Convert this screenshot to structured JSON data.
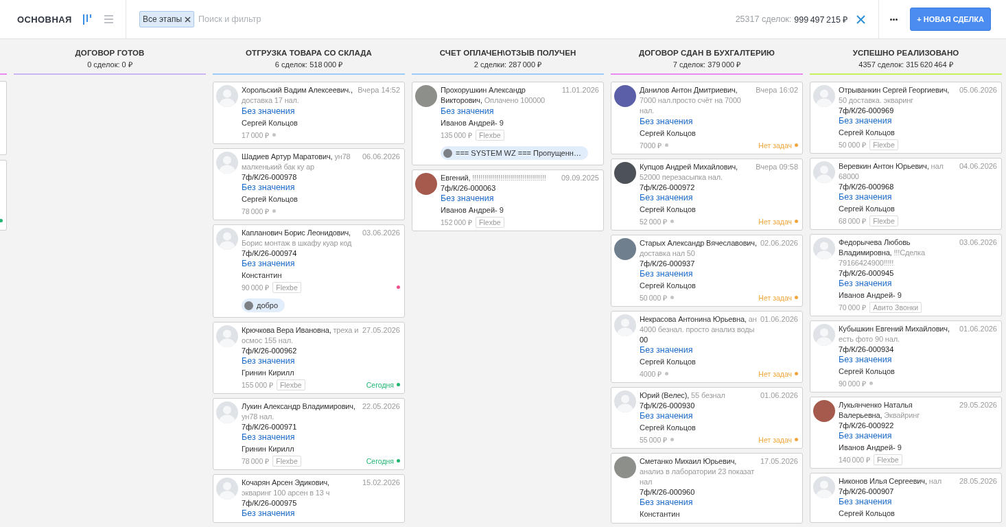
{
  "header": {
    "title": "ОСНОВНАЯ",
    "view_toggles": [
      {
        "kind": "pipeline",
        "selected": true
      },
      {
        "kind": "list",
        "selected": false
      }
    ],
    "filter_chip": "Все этапы",
    "search": {
      "placeholder": "Поиск и фильтр"
    },
    "deals_count": "25317 сделок:",
    "total": "999 497 215 ₽",
    "new_deal_button": "+ НОВАЯ СДЕЛКА"
  },
  "board": {
    "clipped_column": {
      "color": "#e88af0",
      "cards": [
        {
          "today": false
        },
        {
          "today": true
        }
      ]
    },
    "columns": [
      {
        "title": "ДОГОВОР ГОТОВ",
        "summary": "0 сделок: 0 ₽",
        "color": "#c9b5f2"
      },
      {
        "title": "ОТГРУЗКА ТОВАРА СО СКЛАДА",
        "summary": "6 сделок: 518 000 ₽",
        "color": "#99ccf8",
        "cards": [
          {
            "photo": false,
            "name": "Хорольский Вадим Алексеевич.,",
            "note": "доставка 17 нал.",
            "date": "Вчера 14:52",
            "value": "Без значения",
            "responsible": "Сергей Кольцов",
            "price": "17 000 ₽"
          },
          {
            "photo": false,
            "name": "Шадиев Артур Маратович,",
            "note": "ун78 малкенький бак ку ар",
            "date": "06.06.2026",
            "number": "7ф/К/26-000978",
            "value": "Без значения",
            "responsible": "Сергей Кольцов",
            "price": "78 000 ₽"
          },
          {
            "photo": false,
            "name": "Капланович Борис Леонидович,",
            "note": "Борис монтаж в шкафу куар код",
            "date": "03.06.2026",
            "number": "7ф/К/26-000974",
            "value": "Без значения",
            "responsible": "Константин",
            "price": "90 000 ₽",
            "tag": "Flexbe",
            "task": {
              "color": "#f2508c"
            },
            "message": {
              "text": "добро"
            }
          },
          {
            "photo": false,
            "name": "Крючкова Вера Ивановна,",
            "note": "треха и осмос 155 нал.",
            "date": "27.05.2026",
            "number": "7ф/К/26-000962",
            "value": "Без значения",
            "responsible": "Гринин Кирилл",
            "price": "155 000 ₽",
            "tag": "Flexbe",
            "task": {
              "label": "Сегодня",
              "color": "#22b573"
            }
          },
          {
            "photo": false,
            "name": "Лукин Александр Владимирович,",
            "note": "ун78 нал.",
            "date": "22.05.2026",
            "number": "7ф/К/26-000971",
            "value": "Без значения",
            "responsible": "Гринин Кирилл",
            "price": "78 000 ₽",
            "tag": "Flexbe",
            "task": {
              "label": "Сегодня",
              "color": "#22b573"
            }
          },
          {
            "photo": false,
            "name": "Кочарян Арсен Эдикович,",
            "note": "экваринг 100 арсен в 13 ч",
            "date": "15.02.2026",
            "number": "7ф/К/26-000975",
            "value": "Без значения"
          }
        ]
      },
      {
        "title": "СЧЕТ ОПЛАЧЕН\\ОТЗЫВ ПОЛУЧЕН",
        "summary": "2 сделки: 287 000 ₽",
        "color": "#99ccf8",
        "cards": [
          {
            "photo": true,
            "name": "Прохорушкин Александр Викторович,",
            "note": "Оплачено 100000",
            "date": "11.01.2026",
            "value": "Без значения",
            "responsible": "Иванов Андрей- 9",
            "price": "135 000 ₽",
            "tag": "Flexbe",
            "message": {
              "text": "=== SYSTEM WZ === Пропущенн…"
            }
          },
          {
            "photo": true,
            "name": "Евгений,",
            "note": "!!!!!!!!!!!!!!!!!!!!!!!!!!!!!!!!!!!!!",
            "date": "09.09.2025",
            "number": "7ф/К/26-000063",
            "value": "Без значения",
            "responsible": "Иванов Андрей- 9",
            "price": "152 000 ₽",
            "tag": "Flexbe"
          }
        ]
      },
      {
        "title": "ДОГОВОР СДАН В БУХГАЛТЕРИЮ",
        "summary": "7 сделок: 379 000 ₽",
        "color": "#e88af0",
        "cards": [
          {
            "photo": true,
            "name": "Данилов Антон Дмитриевич,",
            "note": "7000 нал.просто счёт на 7000 нал.",
            "date": "Вчера 16:02",
            "value": "Без значения",
            "responsible": "Сергей Кольцов",
            "price": "7000 ₽",
            "task": {
              "label": "Нет задач",
              "color": "#f0a63a"
            }
          },
          {
            "photo": true,
            "name": "Купцов Андрей Михайлович,",
            "note": "52000 перезасыпка нал.",
            "date": "Вчера 09:58",
            "number": "7ф/К/26-000972",
            "value": "Без значения",
            "responsible": "Сергей Кольцов",
            "price": "52 000 ₽",
            "task": {
              "label": "Нет задач",
              "color": "#f0a63a"
            }
          },
          {
            "photo": true,
            "name": "Старых Александр Вячеславович,",
            "note": "доставка нал 50",
            "date": "02.06.2026",
            "number": "7ф/К/26-000937",
            "value": "Без значения",
            "responsible": "Сергей Кольцов",
            "price": "50 000 ₽",
            "task": {
              "label": "Нет задач",
              "color": "#f0a63a"
            }
          },
          {
            "photo": false,
            "name": "Некрасова Антонина Юрьевна,",
            "note": "ан 4000 безнал. просто анализ воды",
            "date": "01.06.2026",
            "number": "00",
            "value": "Без значения",
            "responsible": "Сергей Кольцов",
            "price": "4000 ₽",
            "task": {
              "label": "Нет задач",
              "color": "#f0a63a"
            }
          },
          {
            "photo": false,
            "name": "Юрий (Велес),",
            "note": "55 безнал",
            "date": "01.06.2026",
            "number": "7ф/К/26-000930",
            "value": "Без значения",
            "responsible": "Сергей Кольцов",
            "price": "55 000 ₽",
            "task": {
              "label": "Нет задач",
              "color": "#f0a63a"
            }
          },
          {
            "photo": true,
            "name": "Сметанко Михаил Юрьевич,",
            "note": "анализ в лаборатории 23 показат нал",
            "date": "17.05.2026",
            "number": "7ф/К/26-000960",
            "value": "Без значения",
            "responsible": "Константин"
          }
        ]
      },
      {
        "title": "УСПЕШНО РЕАЛИЗОВАНО",
        "summary": "4357 сделок: 315 620 464 ₽",
        "color": "#c8ef5c",
        "cards": [
          {
            "photo": false,
            "name": "Отрыванкин Сергей Георгиевич,",
            "note": "50 доставка. экваринг",
            "date": "05.06.2026",
            "number": "7ф/К/26-000969",
            "value": "Без значения",
            "responsible": "Сергей Кольцов",
            "price": "50 000 ₽",
            "tag": "Flexbe"
          },
          {
            "photo": false,
            "name": "Веревкин Антон Юрьевич,",
            "note": "нал 68000",
            "date": "04.06.2026",
            "number": "7ф/К/26-000968",
            "value": "Без значения",
            "responsible": "Сергей Кольцов",
            "price": "68 000 ₽",
            "tag": "Flexbe"
          },
          {
            "photo": false,
            "name": "Федорычева Любовь Владимировна,",
            "note": "!!!Сделка 79166424900!!!!!",
            "date": "03.06.2026",
            "number": "7ф/К/26-000945",
            "value": "Без значения",
            "responsible": "Иванов Андрей- 9",
            "price": "70 000 ₽",
            "tag": "Авито Звонки"
          },
          {
            "photo": false,
            "name": "Кубышкин Евгений Михайлович,",
            "note": "есть фото 90 нал.",
            "date": "01.06.2026",
            "number": "7ф/К/26-000934",
            "value": "Без значения",
            "responsible": "Сергей Кольцов",
            "price": "90 000 ₽"
          },
          {
            "photo": true,
            "name": "Лукьянченко Наталья Валерьевна,",
            "note": "Эквайринг",
            "date": "29.05.2026",
            "number": "7ф/К/26-000922",
            "value": "Без значения",
            "responsible": "Иванов Андрей- 9",
            "price": "140 000 ₽",
            "tag": "Flexbe"
          },
          {
            "photo": false,
            "name": "Никонов Илья Сергеевич,",
            "note": "нал",
            "date": "28.05.2026",
            "number": "7ф/К/26-000907",
            "value": "Без значения",
            "responsible": "Сергей Кольцов"
          }
        ]
      }
    ]
  }
}
